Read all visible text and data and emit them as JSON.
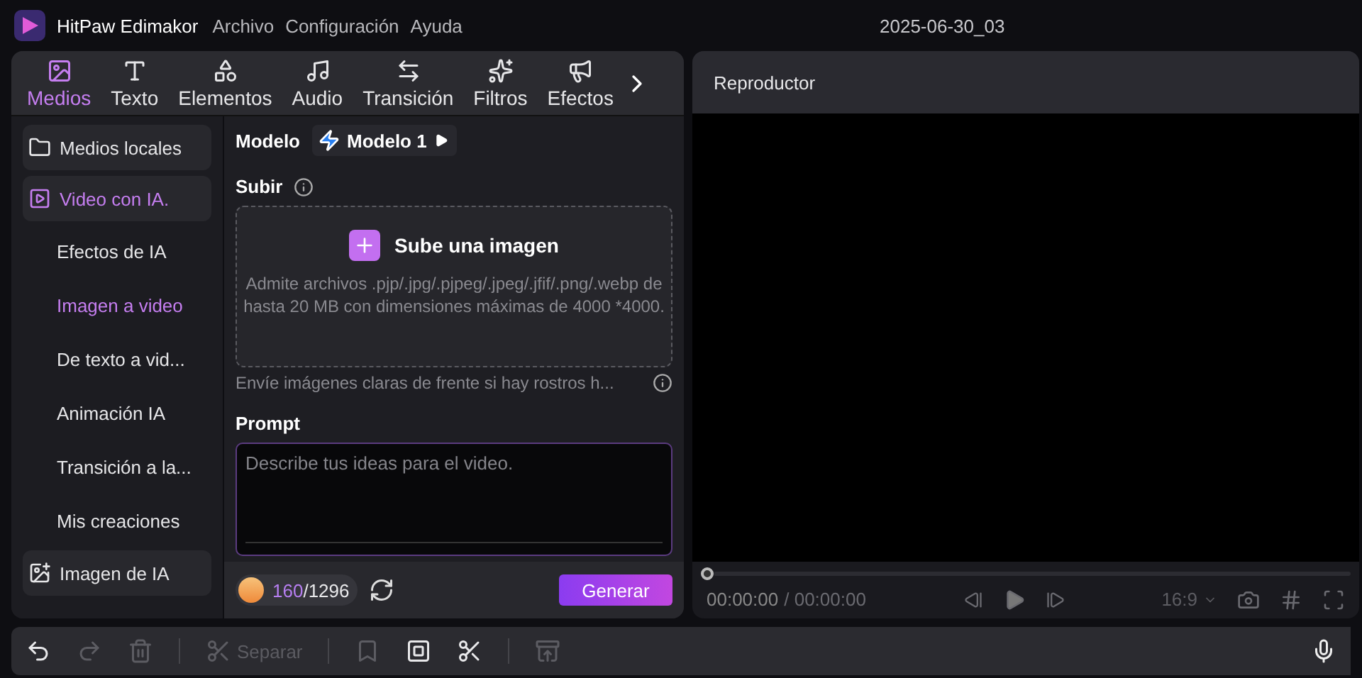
{
  "app": {
    "name": "HitPaw Edimakor"
  },
  "menu": [
    "Archivo",
    "Configuración",
    "Ayuda"
  ],
  "project_title": "2025-06-30_03",
  "tabs": [
    {
      "kind": "media",
      "label": "Medios",
      "selected": true
    },
    {
      "kind": "text",
      "label": "Texto",
      "selected": false
    },
    {
      "kind": "elements",
      "label": "Elementos",
      "selected": false
    },
    {
      "kind": "audio",
      "label": "Audio",
      "selected": false
    },
    {
      "kind": "transition",
      "label": "Transición",
      "selected": false
    },
    {
      "kind": "filters",
      "label": "Filtros",
      "selected": false
    },
    {
      "kind": "effects",
      "label": "Efectos",
      "selected": false
    }
  ],
  "sidebar": [
    {
      "kind": "folder",
      "label": "Medios locales",
      "selected": false
    },
    {
      "kind": "video-ai",
      "label": "Video con IA.",
      "selected": true
    },
    {
      "kind": "sub",
      "label": "Efectos de IA",
      "selected": false
    },
    {
      "kind": "sub",
      "label": "Imagen a video",
      "selected": true
    },
    {
      "kind": "sub",
      "label": "De texto a vid...",
      "selected": false
    },
    {
      "kind": "sub",
      "label": "Animación IA",
      "selected": false
    },
    {
      "kind": "sub",
      "label": "Transición a la...",
      "selected": false
    },
    {
      "kind": "sub",
      "label": "Mis creaciones",
      "selected": false
    },
    {
      "kind": "image-ai",
      "label": "Imagen de IA",
      "selected": false
    }
  ],
  "model": {
    "label": "Modelo",
    "value": "Modelo 1"
  },
  "upload": {
    "label": "Subir",
    "button": "Sube una imagen",
    "description": "Admite archivos .pjp/.jpg/.pjpeg/.jpeg/.jfif/.png/.webp de hasta 20 MB con dimensiones máximas de 4000 *4000.",
    "hint": "Envíe imágenes claras de frente si hay rostros h..."
  },
  "prompt": {
    "label": "Prompt",
    "placeholder": "Describe tus ideas para el video."
  },
  "credits": {
    "used": "160",
    "total": "/1296"
  },
  "generate": "Generar",
  "player": {
    "title": "Reproductor",
    "level": 0,
    "current": "00:00:00",
    "total": "/ 00:00:00",
    "aspect": "16:9"
  },
  "toolbar": [
    {
      "kind": "undo",
      "disabled": false
    },
    {
      "kind": "redo",
      "disabled": true
    },
    {
      "kind": "delete",
      "disabled": true
    },
    {
      "kind": "divider"
    },
    {
      "kind": "split",
      "label": "Separar",
      "disabled": true
    },
    {
      "kind": "divider"
    },
    {
      "kind": "marker",
      "disabled": true
    },
    {
      "kind": "text",
      "disabled": false
    },
    {
      "kind": "cut",
      "disabled": false
    },
    {
      "kind": "divider"
    },
    {
      "kind": "export",
      "disabled": true
    }
  ]
}
